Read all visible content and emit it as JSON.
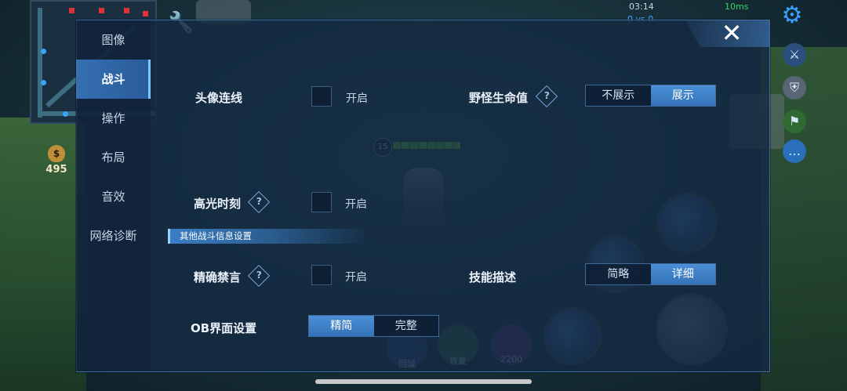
{
  "status_bar": {
    "time": "03:14",
    "ping": "10ms"
  },
  "game": {
    "gold": "495",
    "hero_level": "15",
    "score_hint": "0 vs 0"
  },
  "skills": {
    "recall": "回城",
    "heal": "恢复",
    "cooldown": "2200"
  },
  "tabs": [
    {
      "label": "图像",
      "active": false
    },
    {
      "label": "战斗",
      "active": true
    },
    {
      "label": "操作",
      "active": false
    },
    {
      "label": "布局",
      "active": false
    },
    {
      "label": "音效",
      "active": false
    },
    {
      "label": "网络诊断",
      "active": false
    }
  ],
  "settings": {
    "avatar_link": {
      "label": "头像连线",
      "checkbox_label": "开启",
      "checked": false
    },
    "monster_hp": {
      "label": "野怪生命值",
      "help": "?",
      "options": [
        "不展示",
        "展示"
      ],
      "selected": "展示"
    },
    "highlight": {
      "label": "高光时刻",
      "help": "?",
      "checkbox_label": "开启",
      "checked": false
    },
    "section_title": "其他战斗信息设置",
    "precise_mute": {
      "label": "精确禁言",
      "help": "?",
      "checkbox_label": "开启",
      "checked": false
    },
    "skill_desc": {
      "label": "技能描述",
      "options": [
        "简略",
        "详细"
      ],
      "selected": "详细"
    },
    "ob_ui": {
      "label": "OB界面设置",
      "options": [
        "精简",
        "完整"
      ],
      "selected": "精简"
    }
  },
  "icons": {
    "close": "close-icon",
    "gear": "gear-icon",
    "wrench": "wrench-icon",
    "help": "question-diamond-icon"
  },
  "colors": {
    "accent": "#3573b9",
    "panel": "#142a42",
    "selected": "#4b8fd6"
  }
}
